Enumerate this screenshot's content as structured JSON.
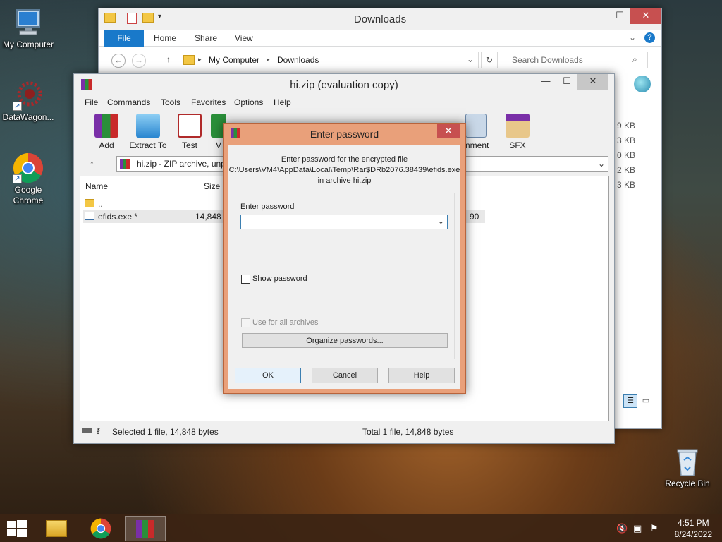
{
  "desktop": {
    "icons": [
      {
        "label": "My Computer"
      },
      {
        "label": "DataWagon..."
      },
      {
        "label": "Google Chrome"
      },
      {
        "label": "Recycle Bin"
      }
    ]
  },
  "explorer": {
    "title": "Downloads",
    "tabs": {
      "file": "File",
      "home": "Home",
      "share": "Share",
      "view": "View"
    },
    "breadcrumb": [
      "My Computer",
      "Downloads"
    ],
    "search_placeholder": "Search Downloads",
    "sizes": [
      "9 KB",
      "3 KB",
      "0 KB",
      "2 KB",
      "3 KB"
    ]
  },
  "winrar": {
    "title": "hi.zip (evaluation copy)",
    "menu": [
      "File",
      "Commands",
      "Tools",
      "Favorites",
      "Options",
      "Help"
    ],
    "toolbar": [
      {
        "label": "Add"
      },
      {
        "label": "Extract To"
      },
      {
        "label": "Test"
      },
      {
        "label": "V"
      },
      {
        "label": "mment"
      },
      {
        "label": "SFX"
      }
    ],
    "path": "hi.zip - ZIP archive, unp",
    "columns": {
      "name": "Name",
      "size": "Size"
    },
    "rows": [
      {
        "name": "..",
        "size": ""
      },
      {
        "name": "efids.exe *",
        "size": "14,848",
        "extra": "90"
      }
    ],
    "status_left": "Selected 1 file, 14,848 bytes",
    "status_right": "Total 1 file, 14,848 bytes"
  },
  "dialog": {
    "title": "Enter password",
    "message_line1": "Enter password for the encrypted file",
    "message_line2": "C:\\Users\\VM4\\AppData\\Local\\Temp\\Rar$DRb2076.38439\\efids.exe",
    "message_line3": "in archive hi.zip",
    "password_label": "Enter password",
    "password_value": "",
    "show_password": "Show password",
    "use_for_all": "Use for all archives",
    "organize": "Organize passwords...",
    "ok": "OK",
    "cancel": "Cancel",
    "help": "Help"
  },
  "taskbar": {
    "time": "4:51 PM",
    "date": "8/24/2022"
  }
}
